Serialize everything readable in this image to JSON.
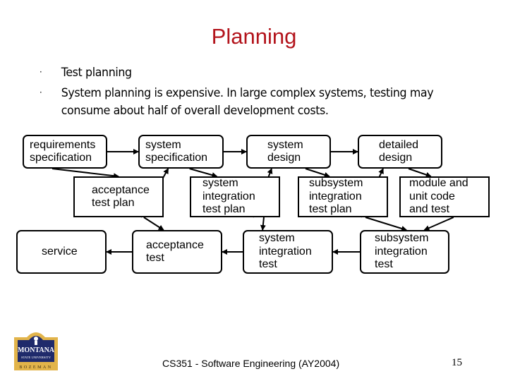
{
  "slide": {
    "title": "Planning",
    "bullets": [
      {
        "marker": "·",
        "text": "Test planning"
      },
      {
        "marker": "·",
        "text": "System planning is expensive.  In large complex systems, testing may consume about half of overall development costs."
      }
    ]
  },
  "diagram": {
    "nodes": {
      "requirements_specification": [
        "requirements",
        "specification"
      ],
      "system_specification": [
        "system",
        "specification"
      ],
      "system_design": [
        "system",
        "design"
      ],
      "detailed_design": [
        "detailed",
        "design"
      ],
      "acceptance_test_plan": [
        "acceptance",
        "test plan"
      ],
      "system_integration_test_plan": [
        "system",
        "integration",
        "test plan"
      ],
      "subsystem_integration_test_plan": [
        "subsystem",
        "integration",
        "test plan"
      ],
      "module_unit_code_test": [
        "module and",
        "unit code",
        "and test"
      ],
      "service": [
        "service"
      ],
      "acceptance_test": [
        "acceptance",
        "test"
      ],
      "system_integration_test": [
        "system",
        "integration",
        "test"
      ],
      "subsystem_integration_test": [
        "subsystem",
        "integration",
        "test"
      ]
    },
    "edges": [
      [
        "requirements_specification",
        "system_specification"
      ],
      [
        "system_specification",
        "system_design"
      ],
      [
        "system_design",
        "detailed_design"
      ],
      [
        "requirements_specification",
        "acceptance_test_plan"
      ],
      [
        "acceptance_test_plan",
        "system_specification"
      ],
      [
        "system_specification",
        "system_integration_test_plan"
      ],
      [
        "system_integration_test_plan",
        "system_design"
      ],
      [
        "system_design",
        "subsystem_integration_test_plan"
      ],
      [
        "subsystem_integration_test_plan",
        "detailed_design"
      ],
      [
        "detailed_design",
        "module_unit_code_test"
      ],
      [
        "acceptance_test_plan",
        "acceptance_test"
      ],
      [
        "system_integration_test_plan",
        "system_integration_test"
      ],
      [
        "subsystem_integration_test_plan",
        "subsystem_integration_test"
      ],
      [
        "module_unit_code_test",
        "subsystem_integration_test"
      ],
      [
        "subsystem_integration_test",
        "system_integration_test"
      ],
      [
        "system_integration_test",
        "acceptance_test"
      ],
      [
        "acceptance_test",
        "service"
      ]
    ]
  },
  "logo": {
    "line1": "MONTANA",
    "line2": "STATE UNIVERSITY",
    "line3": "BOZEMAN",
    "colors": {
      "navy": "#1f2a6b",
      "gold": "#e2b44a"
    }
  },
  "footer": {
    "course": "CS351 - Software Engineering (AY2004)",
    "page_number": "15"
  },
  "colors": {
    "title": "#b3141c"
  }
}
